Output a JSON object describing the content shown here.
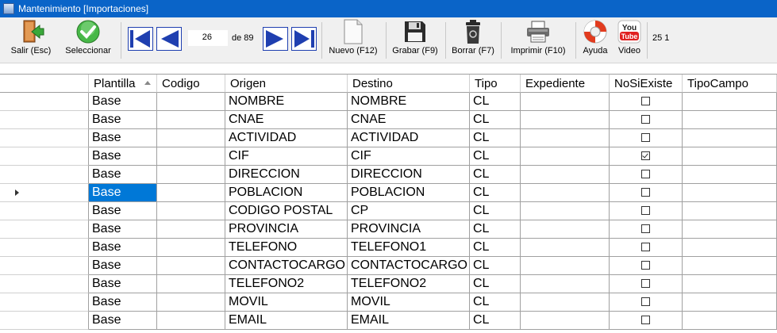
{
  "window": {
    "title": "Mantenimiento [Importaciones]"
  },
  "toolbar": {
    "salir": "Salir (Esc)",
    "seleccionar": "Seleccionar",
    "record_current": "26",
    "record_of": "de 89",
    "nuevo": "Nuevo (F12)",
    "grabar": "Grabar (F9)",
    "borrar": "Borrar (F7)",
    "imprimir": "Imprimir (F10)",
    "ayuda": "Ayuda",
    "video": "Video",
    "youtube_logo_text": "You Tube",
    "counter": "25  1"
  },
  "grid": {
    "columns": [
      "Plantilla",
      "Codigo",
      "Origen",
      "Destino",
      "Tipo",
      "Expediente",
      "NoSiExiste",
      "TipoCampo"
    ],
    "rows": [
      {
        "plantilla": "Base",
        "codigo": "",
        "origen": "NOMBRE",
        "destino": "NOMBRE",
        "tipo": "CL",
        "expediente": "",
        "nosiexiste": false,
        "tipocampo": ""
      },
      {
        "plantilla": "Base",
        "codigo": "",
        "origen": "CNAE",
        "destino": "CNAE",
        "tipo": "CL",
        "expediente": "",
        "nosiexiste": false,
        "tipocampo": ""
      },
      {
        "plantilla": "Base",
        "codigo": "",
        "origen": "ACTIVIDAD",
        "destino": "ACTIVIDAD",
        "tipo": "CL",
        "expediente": "",
        "nosiexiste": false,
        "tipocampo": ""
      },
      {
        "plantilla": "Base",
        "codigo": "",
        "origen": "CIF",
        "destino": "CIF",
        "tipo": "CL",
        "expediente": "",
        "nosiexiste": true,
        "tipocampo": ""
      },
      {
        "plantilla": "Base",
        "codigo": "",
        "origen": "DIRECCION",
        "destino": "DIRECCION",
        "tipo": "CL",
        "expediente": "",
        "nosiexiste": false,
        "tipocampo": ""
      },
      {
        "plantilla": "Base",
        "codigo": "",
        "origen": "POBLACION",
        "destino": "POBLACION",
        "tipo": "CL",
        "expediente": "",
        "nosiexiste": false,
        "tipocampo": "",
        "selected": true
      },
      {
        "plantilla": "Base",
        "codigo": "",
        "origen": "CODIGO POSTAL",
        "destino": "CP",
        "tipo": "CL",
        "expediente": "",
        "nosiexiste": false,
        "tipocampo": ""
      },
      {
        "plantilla": "Base",
        "codigo": "",
        "origen": "PROVINCIA",
        "destino": "PROVINCIA",
        "tipo": "CL",
        "expediente": "",
        "nosiexiste": false,
        "tipocampo": ""
      },
      {
        "plantilla": "Base",
        "codigo": "",
        "origen": "TELEFONO",
        "destino": "TELEFONO1",
        "tipo": "CL",
        "expediente": "",
        "nosiexiste": false,
        "tipocampo": ""
      },
      {
        "plantilla": "Base",
        "codigo": "",
        "origen": "CONTACTOCARGO",
        "destino": "CONTACTOCARGO",
        "tipo": "CL",
        "expediente": "",
        "nosiexiste": false,
        "tipocampo": ""
      },
      {
        "plantilla": "Base",
        "codigo": "",
        "origen": "TELEFONO2",
        "destino": "TELEFONO2",
        "tipo": "CL",
        "expediente": "",
        "nosiexiste": false,
        "tipocampo": ""
      },
      {
        "plantilla": "Base",
        "codigo": "",
        "origen": "MOVIL",
        "destino": "MOVIL",
        "tipo": "CL",
        "expediente": "",
        "nosiexiste": false,
        "tipocampo": ""
      },
      {
        "plantilla": "Base",
        "codigo": "",
        "origen": "EMAIL",
        "destino": "EMAIL",
        "tipo": "CL",
        "expediente": "",
        "nosiexiste": false,
        "tipocampo": ""
      }
    ]
  },
  "colors": {
    "titlebar": "#0a64c8",
    "selection": "#0078d7",
    "nav_arrow": "#1f3fb0"
  }
}
